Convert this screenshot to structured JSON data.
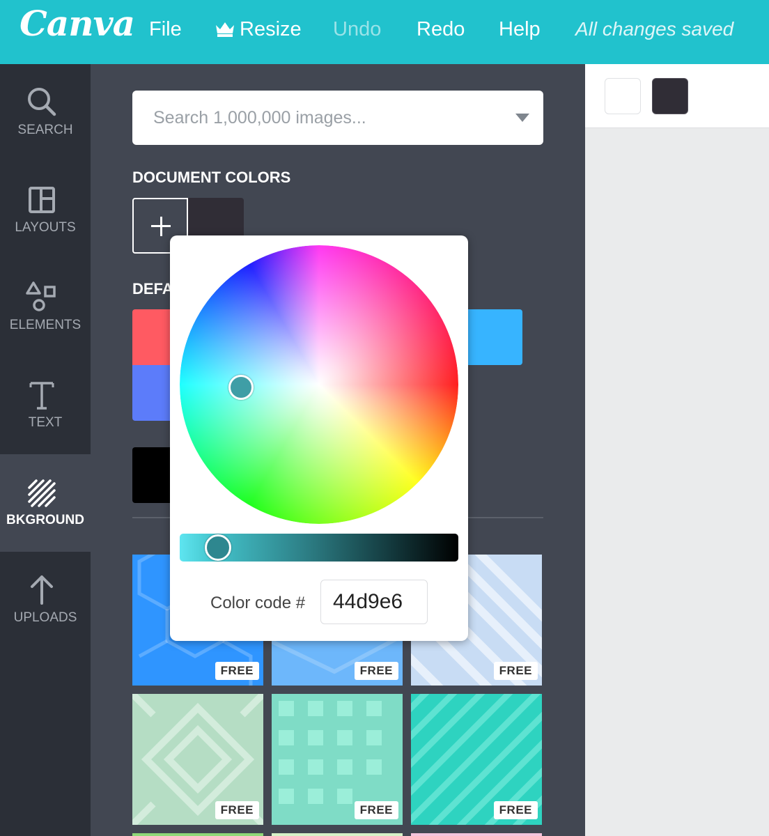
{
  "app": {
    "logo": "Canva"
  },
  "menu": {
    "file": "File",
    "resize": "Resize",
    "undo": "Undo",
    "redo": "Redo",
    "help": "Help",
    "status": "All changes saved"
  },
  "nav": {
    "search": "SEARCH",
    "layouts": "LAYOUTS",
    "elements": "ELEMENTS",
    "text": "TEXT",
    "background": "BKGROUND",
    "uploads": "UPLOADS",
    "active": "background"
  },
  "panel": {
    "search_placeholder": "Search 1,000,000 images...",
    "document_colors_title": "DOCUMENT COLORS",
    "default_colors_title": "DEFA",
    "document_colors": [
      "#302d36"
    ],
    "default_colors": [
      "#ff5a62",
      "#5c7cfa",
      "#37b4ff",
      "#000000"
    ],
    "free_badge": "FREE"
  },
  "color_picker": {
    "label": "Color code #",
    "value": "44d9e6",
    "brightness": 0.14
  },
  "canvas_toolbar": {
    "colors": [
      "#ffffff",
      "#302d36"
    ]
  }
}
